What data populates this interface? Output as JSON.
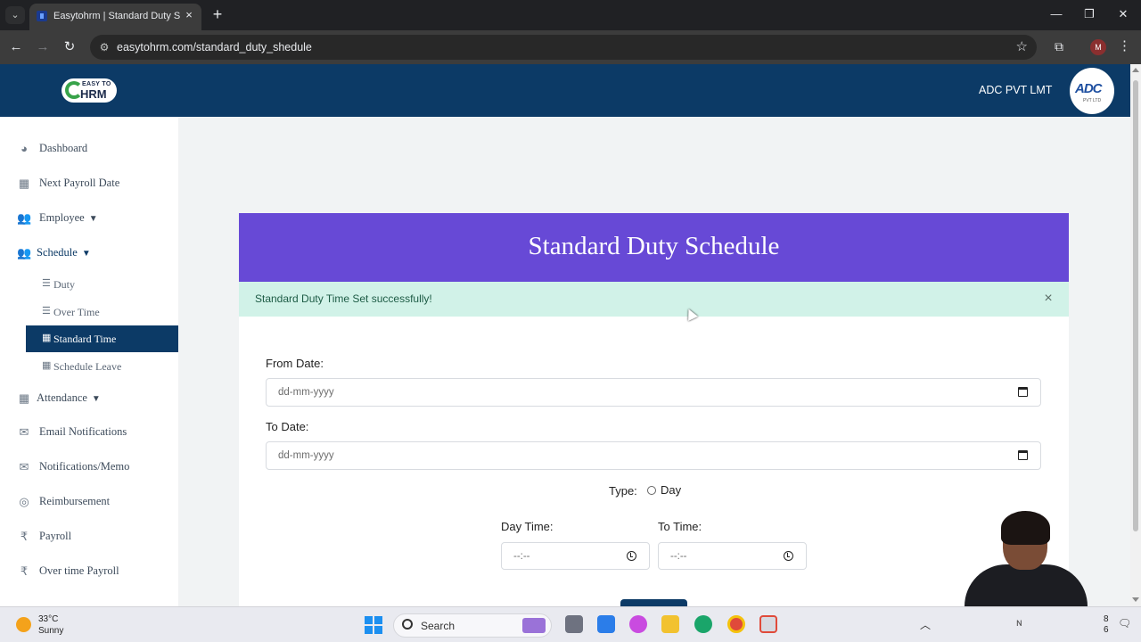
{
  "browser": {
    "tab_title": "Easytohrm | Standard Duty Schedule",
    "url": "easytohrm.com/standard_duty_shedule",
    "profile_initial": "M"
  },
  "header": {
    "logo_top": "EASY TO",
    "logo_bottom": "HRM",
    "company_name": "ADC PVT LMT",
    "company_logo_mark": "ADC",
    "company_logo_sub": "PVT LTD"
  },
  "sidebar": {
    "items": [
      {
        "label": "Dashboard",
        "icon": "palette-icon"
      },
      {
        "label": "Next Payroll Date",
        "icon": "calendar-icon"
      },
      {
        "label": "Employee",
        "icon": "users-icon"
      },
      {
        "label": "Schedule",
        "icon": "users-icon"
      },
      {
        "label": "Attendance",
        "icon": "calendar-icon"
      },
      {
        "label": "Email Notifications",
        "icon": "envelope-icon"
      },
      {
        "label": "Notifications/Memo",
        "icon": "envelope-icon"
      },
      {
        "label": "Reimbursement",
        "icon": "lifebuoy-icon"
      },
      {
        "label": "Payroll",
        "icon": "rupee-icon"
      },
      {
        "label": "Over time Payroll",
        "icon": "rupee-icon"
      }
    ],
    "schedule_sub": [
      {
        "label": "Duty",
        "icon": "list-icon"
      },
      {
        "label": "Over Time",
        "icon": "list-icon"
      },
      {
        "label": "Standard Time",
        "icon": "calendar-icon"
      },
      {
        "label": "Schedule Leave",
        "icon": "calendar-icon"
      }
    ]
  },
  "card": {
    "title": "Standard Duty Schedule",
    "alert": "Standard Duty Time Set successfully!",
    "from_date_label": "From Date:",
    "to_date_label": "To Date:",
    "date_placeholder": "dd-mm-yyyy",
    "type_label": "Type:",
    "type_option": "Day",
    "day_time_label": "Day Time:",
    "to_time_label": "To Time:",
    "time_placeholder": "--:--"
  },
  "taskbar": {
    "temperature": "33°C",
    "weather": "Sunny",
    "search": "Search",
    "clock_line1": "8",
    "clock_line2": "6"
  },
  "colors": {
    "header_bg": "#0c3a66",
    "card_header_bg": "#6749d6",
    "alert_bg": "#d1f2e8"
  }
}
